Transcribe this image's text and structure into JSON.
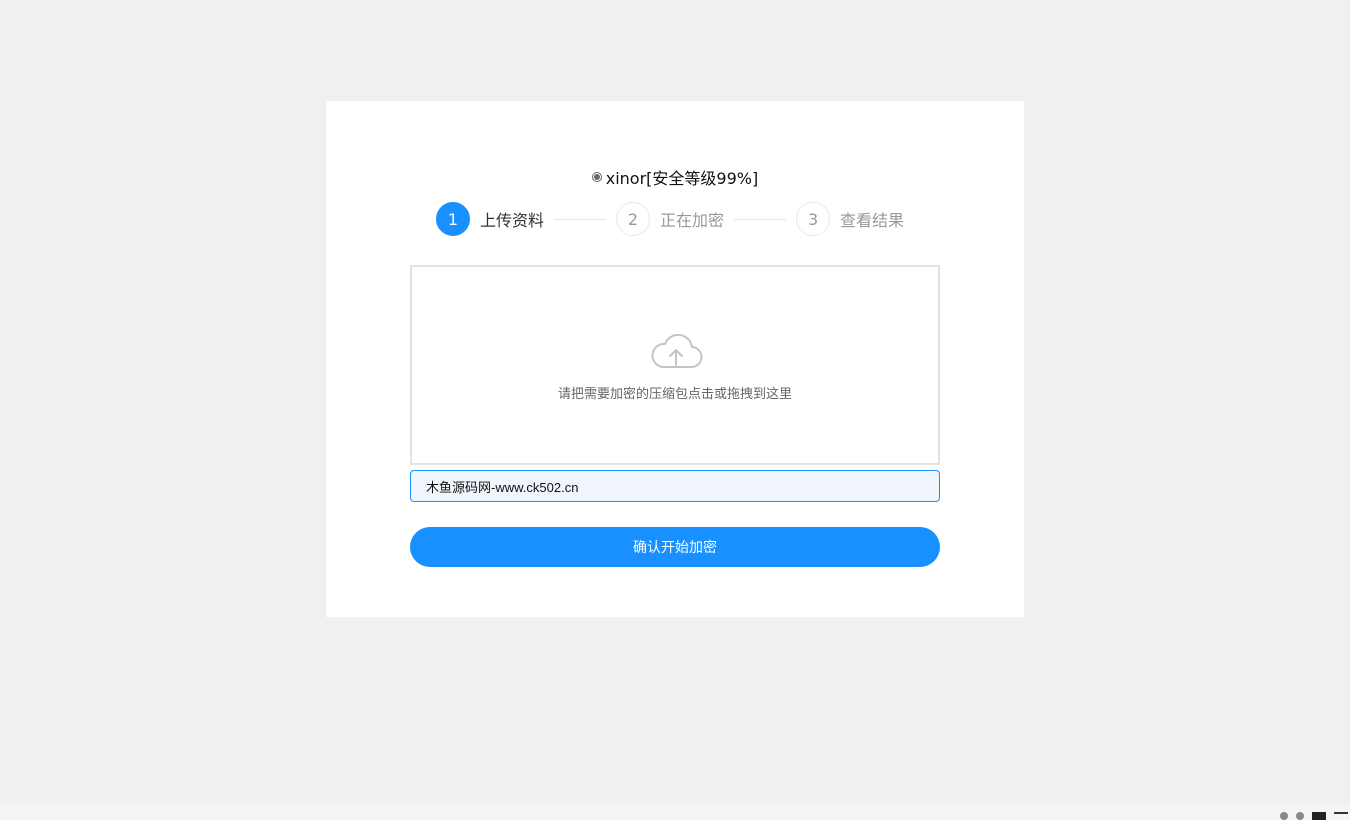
{
  "algorithm": {
    "label": "xinor[安全等级99%]",
    "selected": true
  },
  "steps": [
    {
      "number": "1",
      "label": "上传资料",
      "active": true
    },
    {
      "number": "2",
      "label": "正在加密",
      "active": false
    },
    {
      "number": "3",
      "label": "查看结果",
      "active": false
    }
  ],
  "dropzone": {
    "icon": "cloud-upload-icon",
    "text": "请把需要加密的压缩包点击或拖拽到这里"
  },
  "input": {
    "value": "木鱼源码网-www.ck502.cn"
  },
  "submit": {
    "label": "确认开始加密"
  },
  "colors": {
    "accent": "#1890ff",
    "background": "#f0f0f0",
    "card": "#ffffff"
  }
}
